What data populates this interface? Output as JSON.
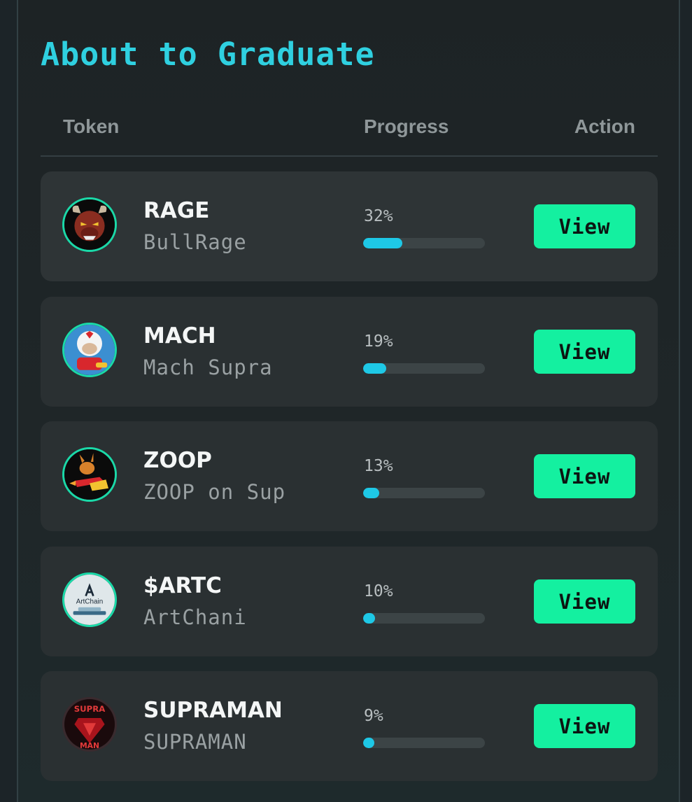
{
  "section": {
    "title": "About to Graduate"
  },
  "table": {
    "headers": {
      "token": "Token",
      "progress": "Progress",
      "action": "Action"
    },
    "rows": [
      {
        "symbol": "RAGE",
        "name": "BullRage",
        "progress": 32,
        "progress_label": "32%",
        "action_label": "View",
        "avatar_icon": "bull-avatar"
      },
      {
        "symbol": "MACH",
        "name": "Mach Supra",
        "progress": 19,
        "progress_label": "19%",
        "action_label": "View",
        "avatar_icon": "racer-avatar"
      },
      {
        "symbol": "ZOOP",
        "name": "ZOOP on Sup",
        "progress": 13,
        "progress_label": "13%",
        "action_label": "View",
        "avatar_icon": "rocket-animal-avatar"
      },
      {
        "symbol": "$ARTC",
        "name": "ArtChani",
        "progress": 10,
        "progress_label": "10%",
        "action_label": "View",
        "avatar_icon": "artchain-logo-avatar",
        "avatar_text": "ArtChain"
      },
      {
        "symbol": "SUPRAMAN",
        "name": "SUPRAMAN",
        "progress": 9,
        "progress_label": "9%",
        "action_label": "View",
        "avatar_icon": "supraman-avatar",
        "avatar_text_top": "SUPRA",
        "avatar_text_bottom": "MAN"
      }
    ]
  },
  "colors": {
    "title": "#2fd0e0",
    "progress_fill": "#1ec8e6",
    "button_bg": "#14f0a0",
    "avatar_ring": "#1ad9a8"
  }
}
